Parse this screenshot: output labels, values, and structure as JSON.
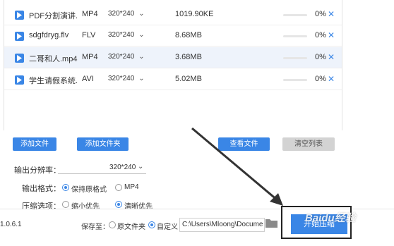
{
  "files": [
    {
      "name": "PDF分割演讲...",
      "format": "MP4",
      "resolution": "320*240",
      "size": "1019.90KE",
      "progress_pct": "0%",
      "progress": 0,
      "selected": false
    },
    {
      "name": "sdgfdryg.flv",
      "format": "FLV",
      "resolution": "320*240",
      "size": "8.68MB",
      "progress_pct": "0%",
      "progress": 0,
      "selected": false
    },
    {
      "name": "二哥和人.mp4",
      "format": "MP4",
      "resolution": "320*240",
      "size": "3.68MB",
      "progress_pct": "0%",
      "progress": 0,
      "selected": true
    },
    {
      "name": "学生请假系统...",
      "format": "AVI",
      "resolution": "320*240",
      "size": "5.02MB",
      "progress_pct": "0%",
      "progress": 0,
      "selected": false
    }
  ],
  "buttons": {
    "add_file": "添加文件",
    "add_folder": "添加文件夹",
    "view_files": "查看文件",
    "clear_list": "清空列表"
  },
  "settings": {
    "resolution_label": "输出分辨率：",
    "resolution_value": "320*240",
    "format_label": "输出格式：",
    "format_keep": "保持原格式",
    "format_mp4": "MP4",
    "compress_label": "压缩选项：",
    "compress_small": "缩小优先",
    "compress_clear": "清晰优先"
  },
  "footer": {
    "version": "1.0.6.1",
    "save_to_label": "保存至：",
    "save_original": "原文件夹",
    "save_custom": "自定义",
    "path_value": "C:\\Users\\Mloong\\Docume",
    "start_label": "开始压缩"
  },
  "watermark": "Baidu经验",
  "colors": {
    "accent": "#3a86e6",
    "disabled": "#d3d3d3",
    "annotation": "#333333"
  }
}
